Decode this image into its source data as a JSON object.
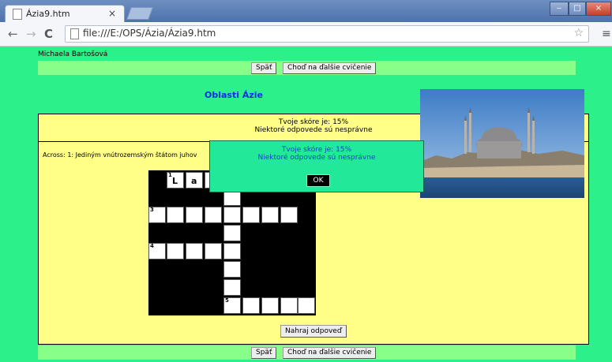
{
  "browser": {
    "tab_title": "Ázia9.htm",
    "tab_close": "×",
    "url": "file:///E:/OPS/Ázia/Ázia9.htm",
    "nav_back": "←",
    "nav_forward": "→",
    "nav_reload": "C",
    "bookmark_star": "☆",
    "menu": "≡"
  },
  "page": {
    "author": "Michaela Bartošová",
    "back_label": "Späť",
    "next_label": "Choď na ďalšie cvičenie",
    "title": "Oblasti Ázie",
    "score_line1": "Tvoje skóre je: 15%",
    "score_line2": "Niektoré odpovede sú nesprávne",
    "clue": "Across: 1: Jediným vnútrozemským štátom juhov",
    "upload_label": "Nahraj odpoveď"
  },
  "crossword": {
    "numbers": {
      "n1": "1",
      "n3": "3",
      "n4": "4",
      "n5": "5"
    },
    "letters": {
      "c1": "L",
      "c2": "a"
    }
  },
  "dialog": {
    "line1": "Tvoje skóre je: 15%",
    "line2": "Niektoré odpovede sú nesprávne",
    "ok_label": "OK"
  },
  "colors": {
    "page_bg": "#2cf08a",
    "nav_bar": "#88ff88",
    "panel": "#ffff88",
    "title": "#0a2ee8",
    "dialog_bg": "#22e89a"
  }
}
